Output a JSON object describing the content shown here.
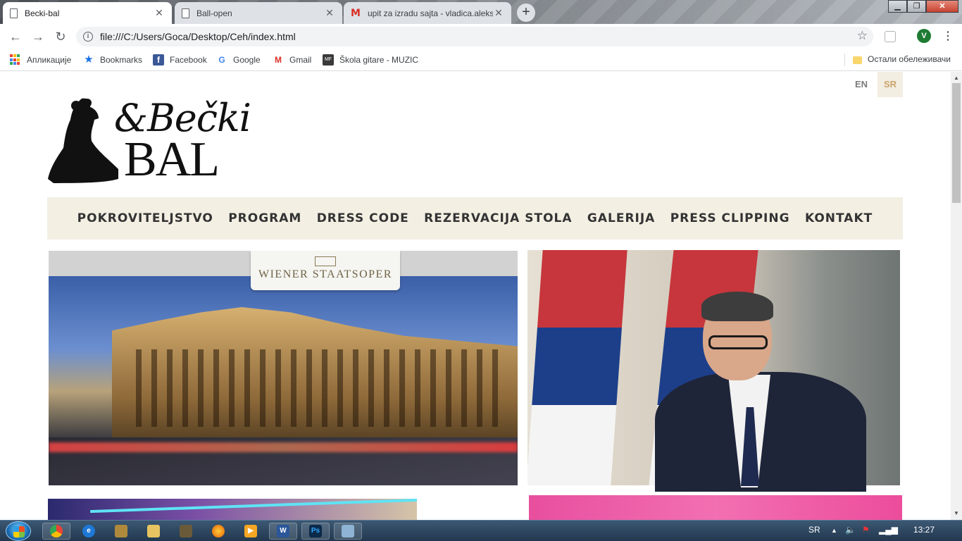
{
  "browser": {
    "tabs": [
      {
        "title": "Becki-bal",
        "favicon": "page-icon",
        "active": true
      },
      {
        "title": "Ball-open",
        "favicon": "page-icon",
        "active": false
      },
      {
        "title": "upit za izradu sajta - vladica.aleks",
        "favicon": "gmail-icon",
        "active": false
      }
    ],
    "url": "file:///C:/Users/Goca/Desktop/Ceh/index.html",
    "profile_initial": "V",
    "bookmarks": [
      {
        "label": "Апликације",
        "icon": "apps-grid-icon"
      },
      {
        "label": "Bookmarks",
        "icon": "star-icon"
      },
      {
        "label": "Facebook",
        "icon": "facebook-icon"
      },
      {
        "label": "Google",
        "icon": "google-icon"
      },
      {
        "label": "Gmail",
        "icon": "gmail-icon"
      },
      {
        "label": "Škola gitare - MUZIC",
        "icon": "music-icon"
      }
    ],
    "other_bookmarks": "Остали обележивачи"
  },
  "site": {
    "languages": [
      "EN",
      "SR"
    ],
    "active_language": "SR",
    "logo": {
      "script": "&Bečki",
      "caps": "BAL"
    },
    "nav": [
      "POKROVITELJSTVO",
      "PROGRAM",
      "DRESS CODE",
      "REZERVACIJA STOLA",
      "GALERIJA",
      "PRESS CLIPPING",
      "KONTAKT"
    ],
    "opera_banner": "WIENER STAATSOPER",
    "colors": {
      "nav_bg": "#f3efe3",
      "accent": "#c9a46b"
    }
  },
  "taskbar": {
    "language": "SR",
    "time": "13:27"
  }
}
